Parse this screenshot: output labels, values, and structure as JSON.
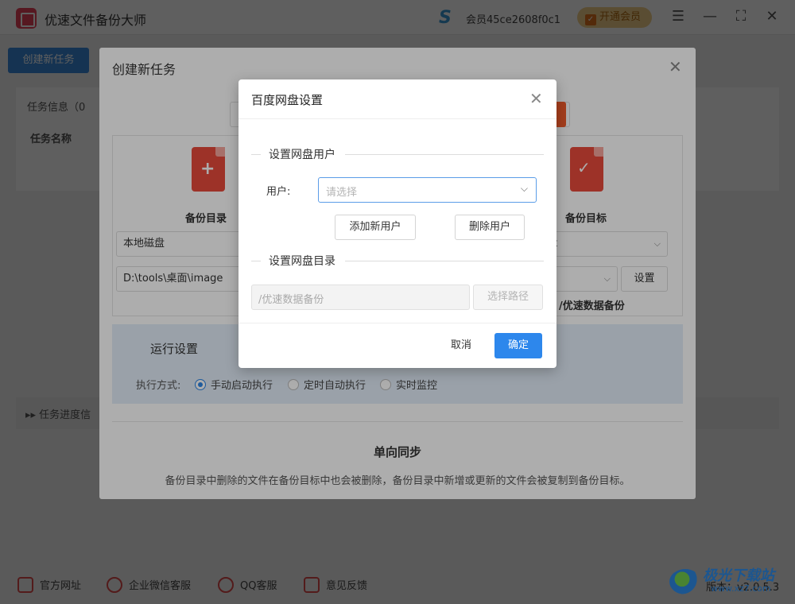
{
  "app": {
    "title": "优速文件备份大师",
    "member_id": "会员45ce2608f0c1",
    "vip_label": "开通会员",
    "new_task": "创建新任务",
    "task_info": "任务信息（0",
    "task_name_col": "任务名称",
    "progress_label": "▸▸ 任务进度信",
    "version": "版本：v2.0.5.3",
    "watermark_title": "极光下载站",
    "watermark_url": "www.xz7.com"
  },
  "footer": {
    "items": [
      {
        "label": "官方网址",
        "icon": "website-icon"
      },
      {
        "label": "企业微信客服",
        "icon": "wechat-service-icon"
      },
      {
        "label": "QQ客服",
        "icon": "qq-icon"
      },
      {
        "label": "意见反馈",
        "icon": "feedback-icon"
      }
    ]
  },
  "create_dialog": {
    "title": "创建新任务",
    "source": {
      "label": "备份目录",
      "type": "本地磁盘",
      "path": "D:\\tools\\桌面\\image",
      "icon": "document-plus-icon"
    },
    "target": {
      "label": "备份目标",
      "type_partial": "t",
      "settings_label": "设置",
      "path": "/优速数据备份",
      "icon": "document-check-icon"
    },
    "run": {
      "title": "运行设置",
      "exec_label": "执行方式:",
      "options": [
        "手动启动执行",
        "定时自动执行",
        "实时监控"
      ],
      "selected": "手动启动执行"
    },
    "mode": {
      "title": "单向同步",
      "desc": "备份目录中删除的文件在备份目标中也会被删除，备份目录中新增或更新的文件会被复制到备份目标。"
    }
  },
  "baidu_dialog": {
    "title": "百度网盘设置",
    "user_section": "设置网盘用户",
    "user_label": "用户:",
    "user_placeholder": "请选择",
    "add_user": "添加新用户",
    "delete_user": "删除用户",
    "dir_section": "设置网盘目录",
    "dir_value": "/优速数据备份",
    "choose_path": "选择路径",
    "cancel": "取消",
    "ok": "确定"
  },
  "colors": {
    "primary": "#2d87ec",
    "accent_red": "#e84a3c",
    "vip": "#f3cf8a"
  }
}
